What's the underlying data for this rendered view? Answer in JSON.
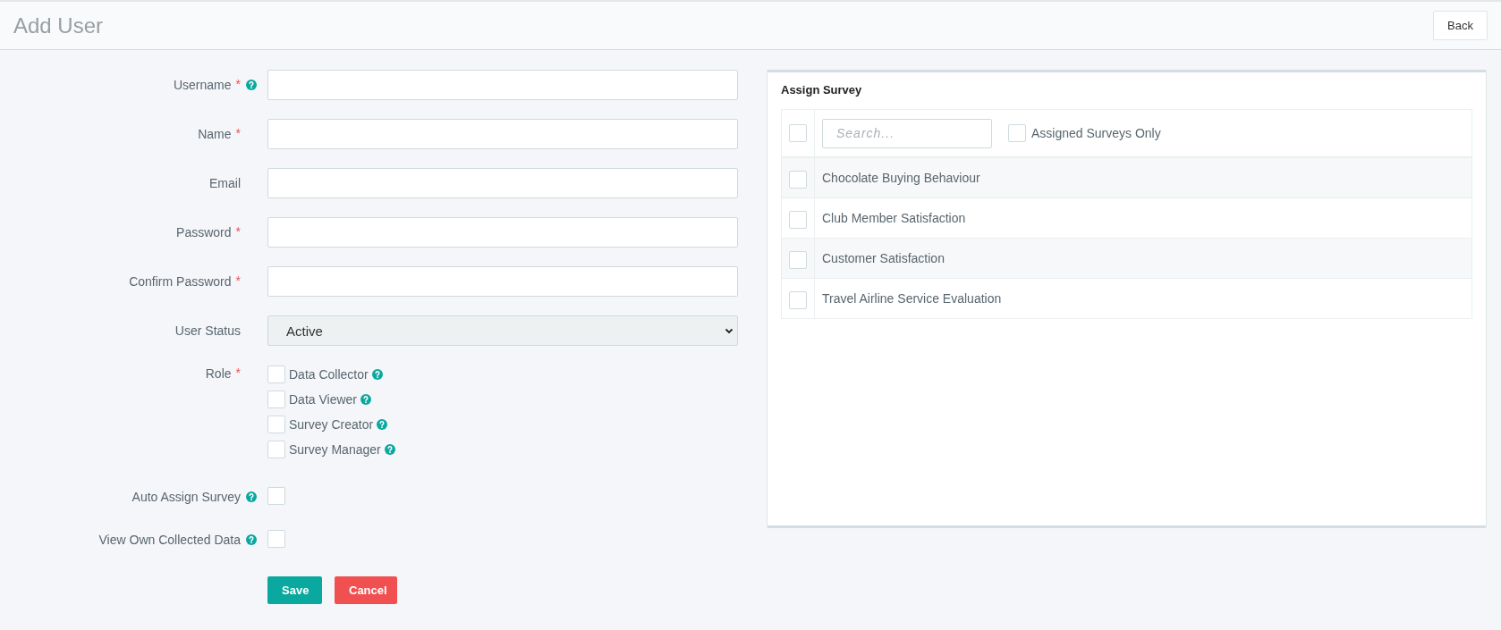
{
  "header": {
    "title": "Add User",
    "back_button": "Back"
  },
  "form": [
    {
      "kind": "text",
      "label": "Username",
      "required_mark": "*",
      "help": true
    },
    {
      "kind": "text",
      "label": "Name",
      "required_mark": "*",
      "help": false
    },
    {
      "kind": "text",
      "label": "Email",
      "help": false
    },
    {
      "kind": "password",
      "label": "Password",
      "required_mark": "*",
      "help": false
    },
    {
      "kind": "password",
      "label": "Confirm Password",
      "required_mark": "*",
      "help": false
    },
    {
      "kind": "select",
      "label": "User Status",
      "help": false,
      "value": "Active"
    },
    {
      "kind": "checkboxes",
      "label": "Role",
      "required_mark": "*",
      "help": false,
      "options": [
        {
          "label": "Data Collector",
          "checked": false,
          "help": true
        },
        {
          "label": "Data Viewer",
          "checked": false,
          "help": true
        },
        {
          "label": "Survey Creator",
          "checked": false,
          "help": true
        },
        {
          "label": "Survey Manager",
          "checked": false,
          "help": true
        }
      ]
    },
    {
      "kind": "checkbox",
      "label": "Auto Assign Survey",
      "help": true,
      "checked": false
    },
    {
      "kind": "checkbox",
      "label": "View Own Collected Data",
      "help": true,
      "checked": false
    }
  ],
  "actions": [
    {
      "label": "Save",
      "kind": "primary"
    },
    {
      "label": "Cancel",
      "kind": "danger"
    }
  ],
  "assign_survey": {
    "title": "Assign Survey",
    "select_all_checked": false,
    "search": {
      "placeholder": "Search..."
    },
    "assigned_only": {
      "label": "Assigned Surveys Only",
      "checked": false
    },
    "surveys": [
      {
        "name": "Chocolate Buying Behaviour",
        "checked": false
      },
      {
        "name": "Club Member Satisfaction",
        "checked": false
      },
      {
        "name": "Customer Satisfaction",
        "checked": false
      },
      {
        "name": "Travel Airline Service Evaluation",
        "checked": false
      }
    ]
  }
}
